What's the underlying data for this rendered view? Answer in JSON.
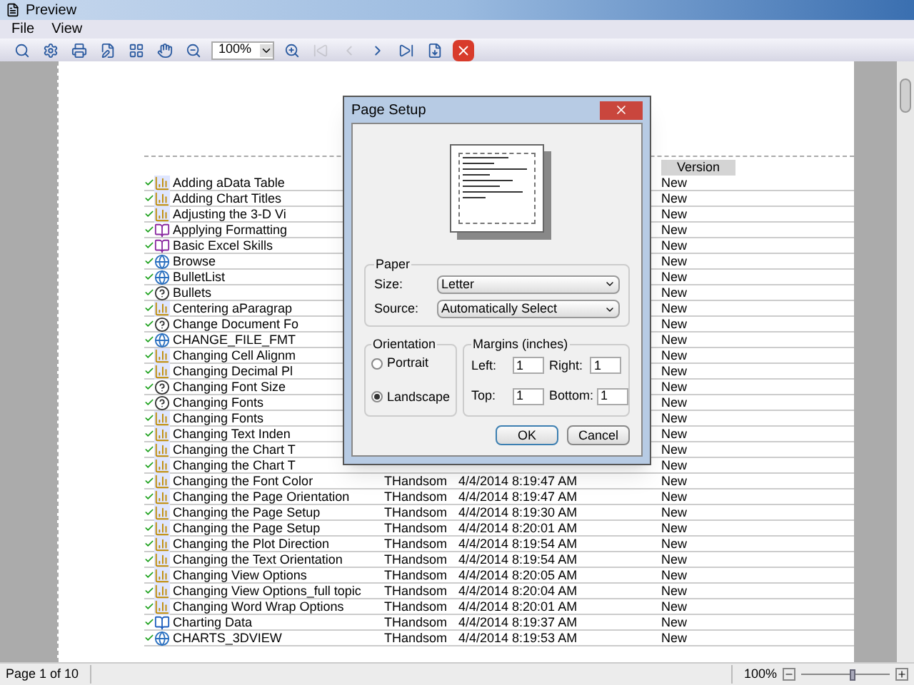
{
  "window": {
    "title": "Preview"
  },
  "menu": [
    "File",
    "View"
  ],
  "toolbar": {
    "zoom": "100%",
    "items": [
      {
        "kind": "find",
        "disabled": false
      },
      {
        "kind": "setup",
        "disabled": false
      },
      {
        "kind": "print",
        "disabled": false
      },
      {
        "kind": "edit",
        "disabled": false
      },
      {
        "kind": "layout",
        "disabled": false
      },
      {
        "kind": "hand",
        "disabled": false
      },
      {
        "kind": "zoomout",
        "disabled": false
      },
      {
        "kind": "zoombox",
        "disabled": false
      },
      {
        "kind": "zoomin",
        "disabled": false
      },
      {
        "kind": "first",
        "disabled": true
      },
      {
        "kind": "prev",
        "disabled": true
      },
      {
        "kind": "next",
        "disabled": false
      },
      {
        "kind": "last",
        "disabled": false
      },
      {
        "kind": "export",
        "disabled": false
      },
      {
        "kind": "close",
        "disabled": false
      }
    ]
  },
  "table": {
    "columns": [
      "Version"
    ],
    "rows": [
      {
        "checked": true,
        "kind": "chart",
        "name": "Adding aData Table",
        "version": "New"
      },
      {
        "checked": true,
        "kind": "chart",
        "name": "Adding Chart Titles",
        "version": "New"
      },
      {
        "checked": true,
        "kind": "chart",
        "name": "Adjusting the 3-D Vi",
        "version": "New"
      },
      {
        "checked": true,
        "kind": "book",
        "name": "Applying Formatting",
        "version": "New"
      },
      {
        "checked": true,
        "kind": "book",
        "name": "Basic Excel Skills",
        "version": "New"
      },
      {
        "checked": true,
        "kind": "globe",
        "name": "Browse",
        "version": "New"
      },
      {
        "checked": true,
        "kind": "globe",
        "name": "BulletList",
        "version": "New"
      },
      {
        "checked": true,
        "kind": "help",
        "name": "Bullets",
        "version": "New"
      },
      {
        "checked": true,
        "kind": "chart",
        "name": "Centering aParagrap",
        "version": "New"
      },
      {
        "checked": true,
        "kind": "help",
        "name": "Change Document Fo",
        "version": "New"
      },
      {
        "checked": true,
        "kind": "globe",
        "name": "CHANGE_FILE_FMT",
        "version": "New"
      },
      {
        "checked": true,
        "kind": "chart",
        "name": "Changing Cell Alignm",
        "version": "New"
      },
      {
        "checked": true,
        "kind": "chart",
        "name": "Changing Decimal Pl",
        "version": "New"
      },
      {
        "checked": true,
        "kind": "help",
        "name": "Changing Font Size",
        "version": "New"
      },
      {
        "checked": true,
        "kind": "help",
        "name": "Changing Fonts",
        "version": "New"
      },
      {
        "checked": true,
        "kind": "chart",
        "name": "Changing Fonts",
        "version": "New"
      },
      {
        "checked": true,
        "kind": "chart",
        "name": "Changing Text Inden",
        "version": "New"
      },
      {
        "checked": true,
        "kind": "chart",
        "name": "Changing the Chart T",
        "version": "New"
      },
      {
        "checked": true,
        "kind": "chart",
        "name": "Changing the Chart T",
        "version": "New"
      },
      {
        "checked": true,
        "kind": "chart",
        "name": "Changing the Font Color",
        "author": "THandsom",
        "date": "4/4/2014 8:19:47 AM",
        "version": "New"
      },
      {
        "checked": true,
        "kind": "chart",
        "name": "Changing the Page Orientation",
        "author": "THandsom",
        "date": "4/4/2014 8:19:47 AM",
        "version": "New"
      },
      {
        "checked": true,
        "kind": "chart",
        "name": "Changing the Page Setup",
        "author": "THandsom",
        "date": "4/4/2014 8:19:30 AM",
        "version": "New"
      },
      {
        "checked": true,
        "kind": "chart",
        "name": "Changing the Page Setup",
        "author": "THandsom",
        "date": "4/4/2014 8:20:01 AM",
        "version": "New"
      },
      {
        "checked": true,
        "kind": "chart",
        "name": "Changing the Plot Direction",
        "author": "THandsom",
        "date": "4/4/2014 8:19:54 AM",
        "version": "New"
      },
      {
        "checked": true,
        "kind": "chart",
        "name": "Changing the Text Orientation",
        "author": "THandsom",
        "date": "4/4/2014 8:19:54 AM",
        "version": "New"
      },
      {
        "checked": true,
        "kind": "chart",
        "name": "Changing View Options",
        "author": "THandsom",
        "date": "4/4/2014 8:20:05 AM",
        "version": "New"
      },
      {
        "checked": true,
        "kind": "chart",
        "name": "Changing View Options_full topic",
        "author": "THandsom",
        "date": "4/4/2014 8:20:04 AM",
        "version": "New"
      },
      {
        "checked": true,
        "kind": "chart",
        "name": "Changing Word Wrap Options",
        "author": "THandsom",
        "date": "4/4/2014 8:20:01 AM",
        "version": "New"
      },
      {
        "checked": true,
        "kind": "bluebook",
        "name": "Charting Data",
        "author": "THandsom",
        "date": "4/4/2014 8:19:37 AM",
        "version": "New"
      },
      {
        "checked": true,
        "kind": "globe",
        "name": "CHARTS_3DVIEW",
        "author": "THandsom",
        "date": "4/4/2014 8:19:53 AM",
        "version": "New"
      }
    ]
  },
  "dialog": {
    "title": "Page Setup",
    "paper": {
      "label": "Paper",
      "size_label": "Size:",
      "size": "Letter",
      "source_label": "Source:",
      "source": "Automatically Select"
    },
    "orientation": {
      "label": "Orientation",
      "options": [
        {
          "label": "Portrait",
          "selected": false
        },
        {
          "label": "Landscape",
          "selected": true
        }
      ]
    },
    "margins": {
      "label": "Margins (inches)",
      "fields": [
        {
          "label": "Left:",
          "value": "1"
        },
        {
          "label": "Right:",
          "value": "1"
        },
        {
          "label": "Top:",
          "value": "1"
        },
        {
          "label": "Bottom:",
          "value": "1"
        }
      ]
    },
    "buttons": [
      "OK",
      "Cancel"
    ]
  },
  "status_bar": {
    "page": "Page 1 of 10",
    "zoom": "100%",
    "zoom_slider": {
      "level": 0.58
    }
  }
}
